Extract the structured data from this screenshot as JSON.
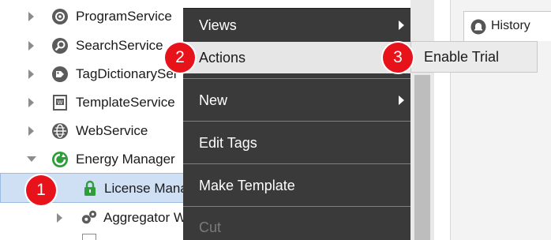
{
  "tree": {
    "items": [
      {
        "label": "ProgramService",
        "icon": "gear-icon"
      },
      {
        "label": "SearchService",
        "icon": "magnifier-icon"
      },
      {
        "label": "TagDictionarySer",
        "icon": "tag-icon"
      },
      {
        "label": "TemplateService",
        "icon": "template-icon"
      },
      {
        "label": "WebService",
        "icon": "globe-icon"
      },
      {
        "label": "Energy Manager",
        "icon": "energy-manager-icon"
      },
      {
        "label": "License Mana",
        "icon": "lock-icon"
      },
      {
        "label": "Aggregator W",
        "icon": "gears-icon"
      }
    ]
  },
  "right_pane": {
    "tab_label": "History",
    "tab_icon": "history-bell-icon"
  },
  "context_menu": {
    "items": [
      {
        "label": "Views",
        "has_submenu": true
      },
      {
        "label": "Actions",
        "has_submenu": true
      },
      {
        "label": "New",
        "has_submenu": true
      },
      {
        "label": "Edit Tags",
        "has_submenu": false
      },
      {
        "label": "Make Template",
        "has_submenu": false
      },
      {
        "label": "Cut",
        "has_submenu": false
      }
    ]
  },
  "submenu": {
    "item_label": "Enable Trial"
  },
  "badges": {
    "step1": "1",
    "step2": "2",
    "step3": "3"
  },
  "colors": {
    "badge": "#e8121a",
    "menu_bg": "#3a3a3a",
    "selection": "#cfe0f5"
  }
}
